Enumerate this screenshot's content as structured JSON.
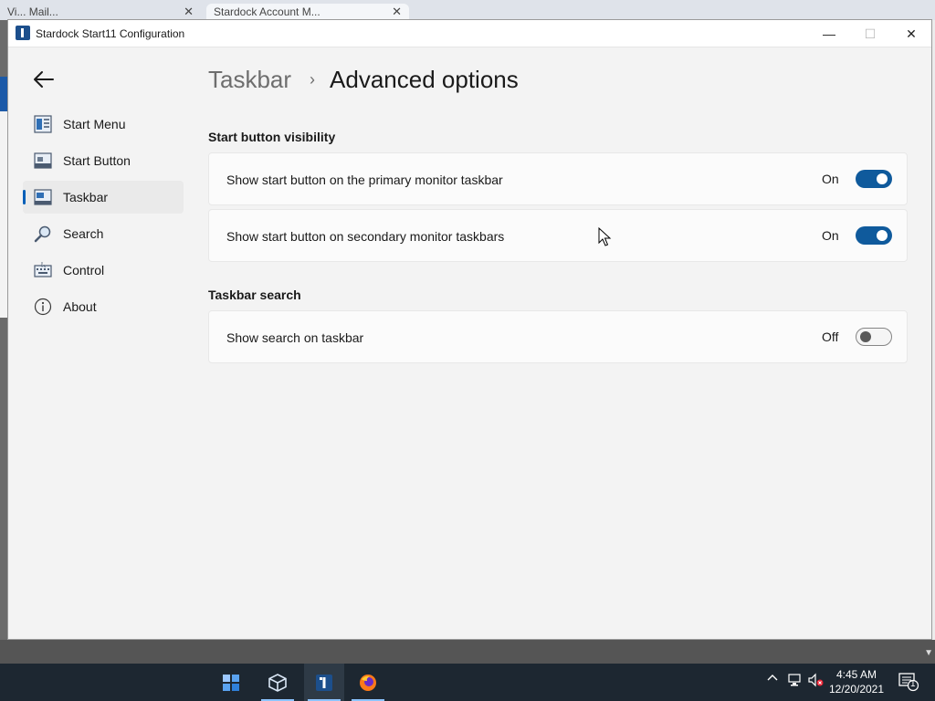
{
  "background": {
    "tab1_label": "Vi... Mail...",
    "tab2_label": "Stardock Account M..."
  },
  "window": {
    "title": "Stardock Start11 Configuration",
    "minimize": "—",
    "maximize": "☐",
    "close": "✕"
  },
  "nav": {
    "back": "←",
    "items": [
      {
        "label": "Start Menu",
        "icon": "start-menu-icon"
      },
      {
        "label": "Start Button",
        "icon": "start-button-icon"
      },
      {
        "label": "Taskbar",
        "icon": "taskbar-icon",
        "active": true
      },
      {
        "label": "Search",
        "icon": "search-icon"
      },
      {
        "label": "Control",
        "icon": "control-icon"
      },
      {
        "label": "About",
        "icon": "info-icon"
      }
    ]
  },
  "breadcrumb": {
    "parent": "Taskbar",
    "separator": "›",
    "current": "Advanced options"
  },
  "sections": [
    {
      "title": "Start button visibility",
      "settings": [
        {
          "label": "Show start button on the primary monitor taskbar",
          "state": "On",
          "on": true
        },
        {
          "label": "Show start button on secondary monitor taskbars",
          "state": "On",
          "on": true
        }
      ]
    },
    {
      "title": "Taskbar search",
      "settings": [
        {
          "label": "Show search on taskbar",
          "state": "Off",
          "on": false
        }
      ]
    }
  ],
  "taskbar": {
    "time": "4:45 AM",
    "date": "12/20/2021",
    "notification_count": "1"
  },
  "colors": {
    "accent": "#0f5a9c",
    "window_bg": "#f3f3f3",
    "card_bg": "#fbfbfb",
    "taskbar_bg": "#1d2731"
  }
}
